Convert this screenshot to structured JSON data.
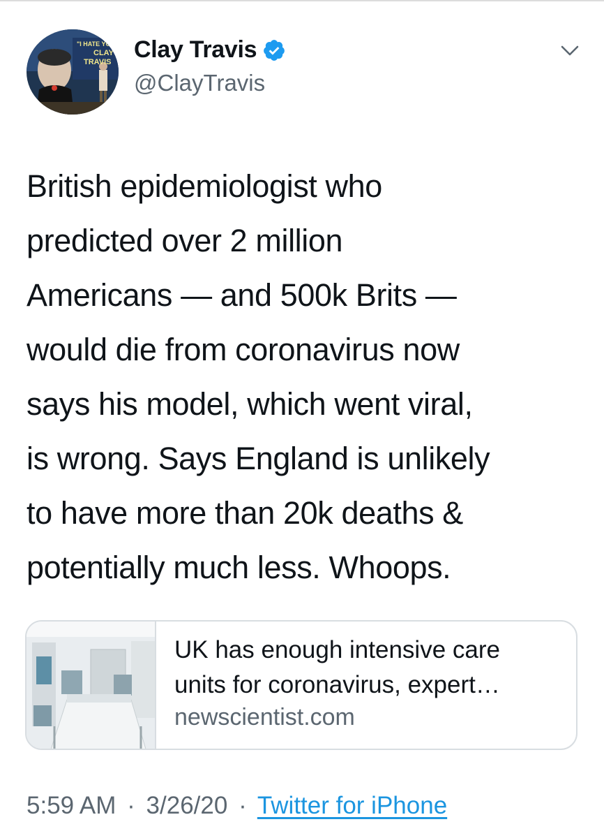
{
  "tweet": {
    "author": {
      "display_name": "Clay Travis",
      "handle": "@ClayTravis",
      "verified": true,
      "avatar_sign_text": [
        "\"I HATE YOU",
        "CLAY",
        "TRAVIS"
      ]
    },
    "text": "British epidemiologist who\npredicted over 2 million\nAmericans — and 500k Brits —\nwould die from coronavirus now\nsays his model, which went viral,\nis wrong. Says England is unlikely\nto have more than 20k deaths &\npotentially much less. Whoops.",
    "link_card": {
      "title_line1": "UK has enough intensive care",
      "title_line2": "units for coronavirus, expert…",
      "domain": "newscientist.com"
    },
    "meta": {
      "time": "5:59 AM",
      "date": "3/26/20",
      "separator": "·",
      "source": "Twitter for iPhone"
    }
  },
  "icons": {
    "verified": "verified-badge-icon",
    "menu": "chevron-down-icon"
  },
  "colors": {
    "text": "#0f1419",
    "secondary_text": "#5b6670",
    "verified_blue": "#1d9bf0",
    "link_blue": "#1b95e0",
    "card_border": "#d8dde1"
  }
}
